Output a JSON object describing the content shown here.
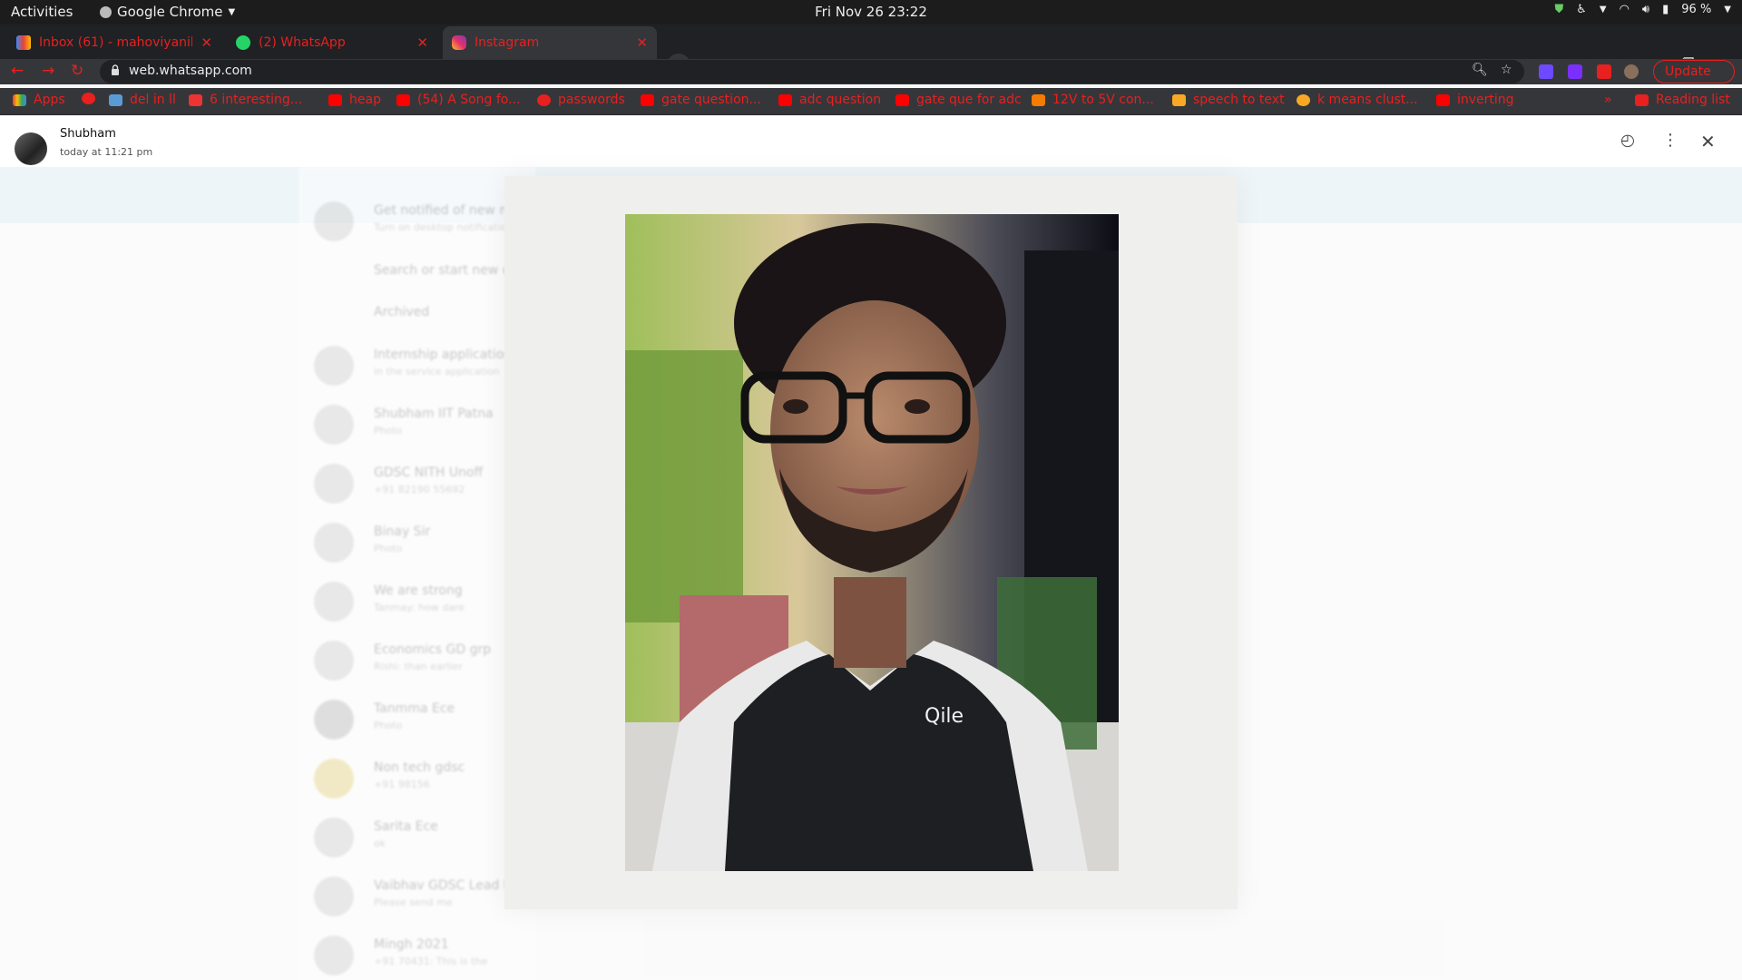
{
  "os_bar": {
    "activities": "Activities",
    "app_name": "Google Chrome",
    "clock": "Fri Nov 26  23:22",
    "battery": "96 %"
  },
  "tabs": [
    {
      "title": "Inbox (61) - mahoviyanik",
      "icon": "gmail-icon"
    },
    {
      "title": "(2) WhatsApp",
      "icon": "whatsapp-icon"
    },
    {
      "title": "Instagram",
      "icon": "instagram-icon"
    }
  ],
  "address_bar": {
    "url": "web.whatsapp.com",
    "update_label": "Update"
  },
  "bookmarks": [
    {
      "label": "Apps"
    },
    {
      "label": "del in ll"
    },
    {
      "label": "6 interesting..."
    },
    {
      "label": "heap"
    },
    {
      "label": "(54) A Song fo..."
    },
    {
      "label": "passwords"
    },
    {
      "label": "gate question..."
    },
    {
      "label": "adc question"
    },
    {
      "label": "gate que for adc"
    },
    {
      "label": "12V to 5V con..."
    },
    {
      "label": "speech to text"
    },
    {
      "label": "k means clust..."
    },
    {
      "label": "inverting"
    },
    {
      "label": "»"
    },
    {
      "label": "Reading list"
    }
  ],
  "viewer": {
    "sender": "Shubham",
    "timestamp": "today at 11:21 pm"
  },
  "background_chats": [
    {
      "name": "Get notified of new mess...",
      "preview": "Turn on desktop notifications"
    },
    {
      "name": "Search or start new chat",
      "preview": ""
    },
    {
      "name": "Archived",
      "preview": ""
    },
    {
      "name": "Internship application",
      "preview": "in the service application"
    },
    {
      "name": "Shubham IIT Patna",
      "preview": "Photo"
    },
    {
      "name": "GDSC NITH Unoff",
      "preview": "+91 82190 55692"
    },
    {
      "name": "Binay Sir",
      "preview": "Photo"
    },
    {
      "name": "We are strong",
      "preview": "Tanmay: how dare"
    },
    {
      "name": "Economics GD grp",
      "preview": "Rishi: than earlier"
    },
    {
      "name": "Tanmma Ece",
      "preview": "Photo"
    },
    {
      "name": "Non tech gdsc",
      "preview": "+91 98156"
    },
    {
      "name": "Sarita Ece",
      "preview": "ok"
    },
    {
      "name": "Vaibhav GDSC Lead N",
      "preview": "Please send me"
    },
    {
      "name": "Mingh 2021",
      "preview": "+91 70431: This is the"
    }
  ],
  "colors": {
    "chrome_accent": "#e8201f",
    "topbar": "#1c1c1c",
    "stage": "#efefed"
  }
}
